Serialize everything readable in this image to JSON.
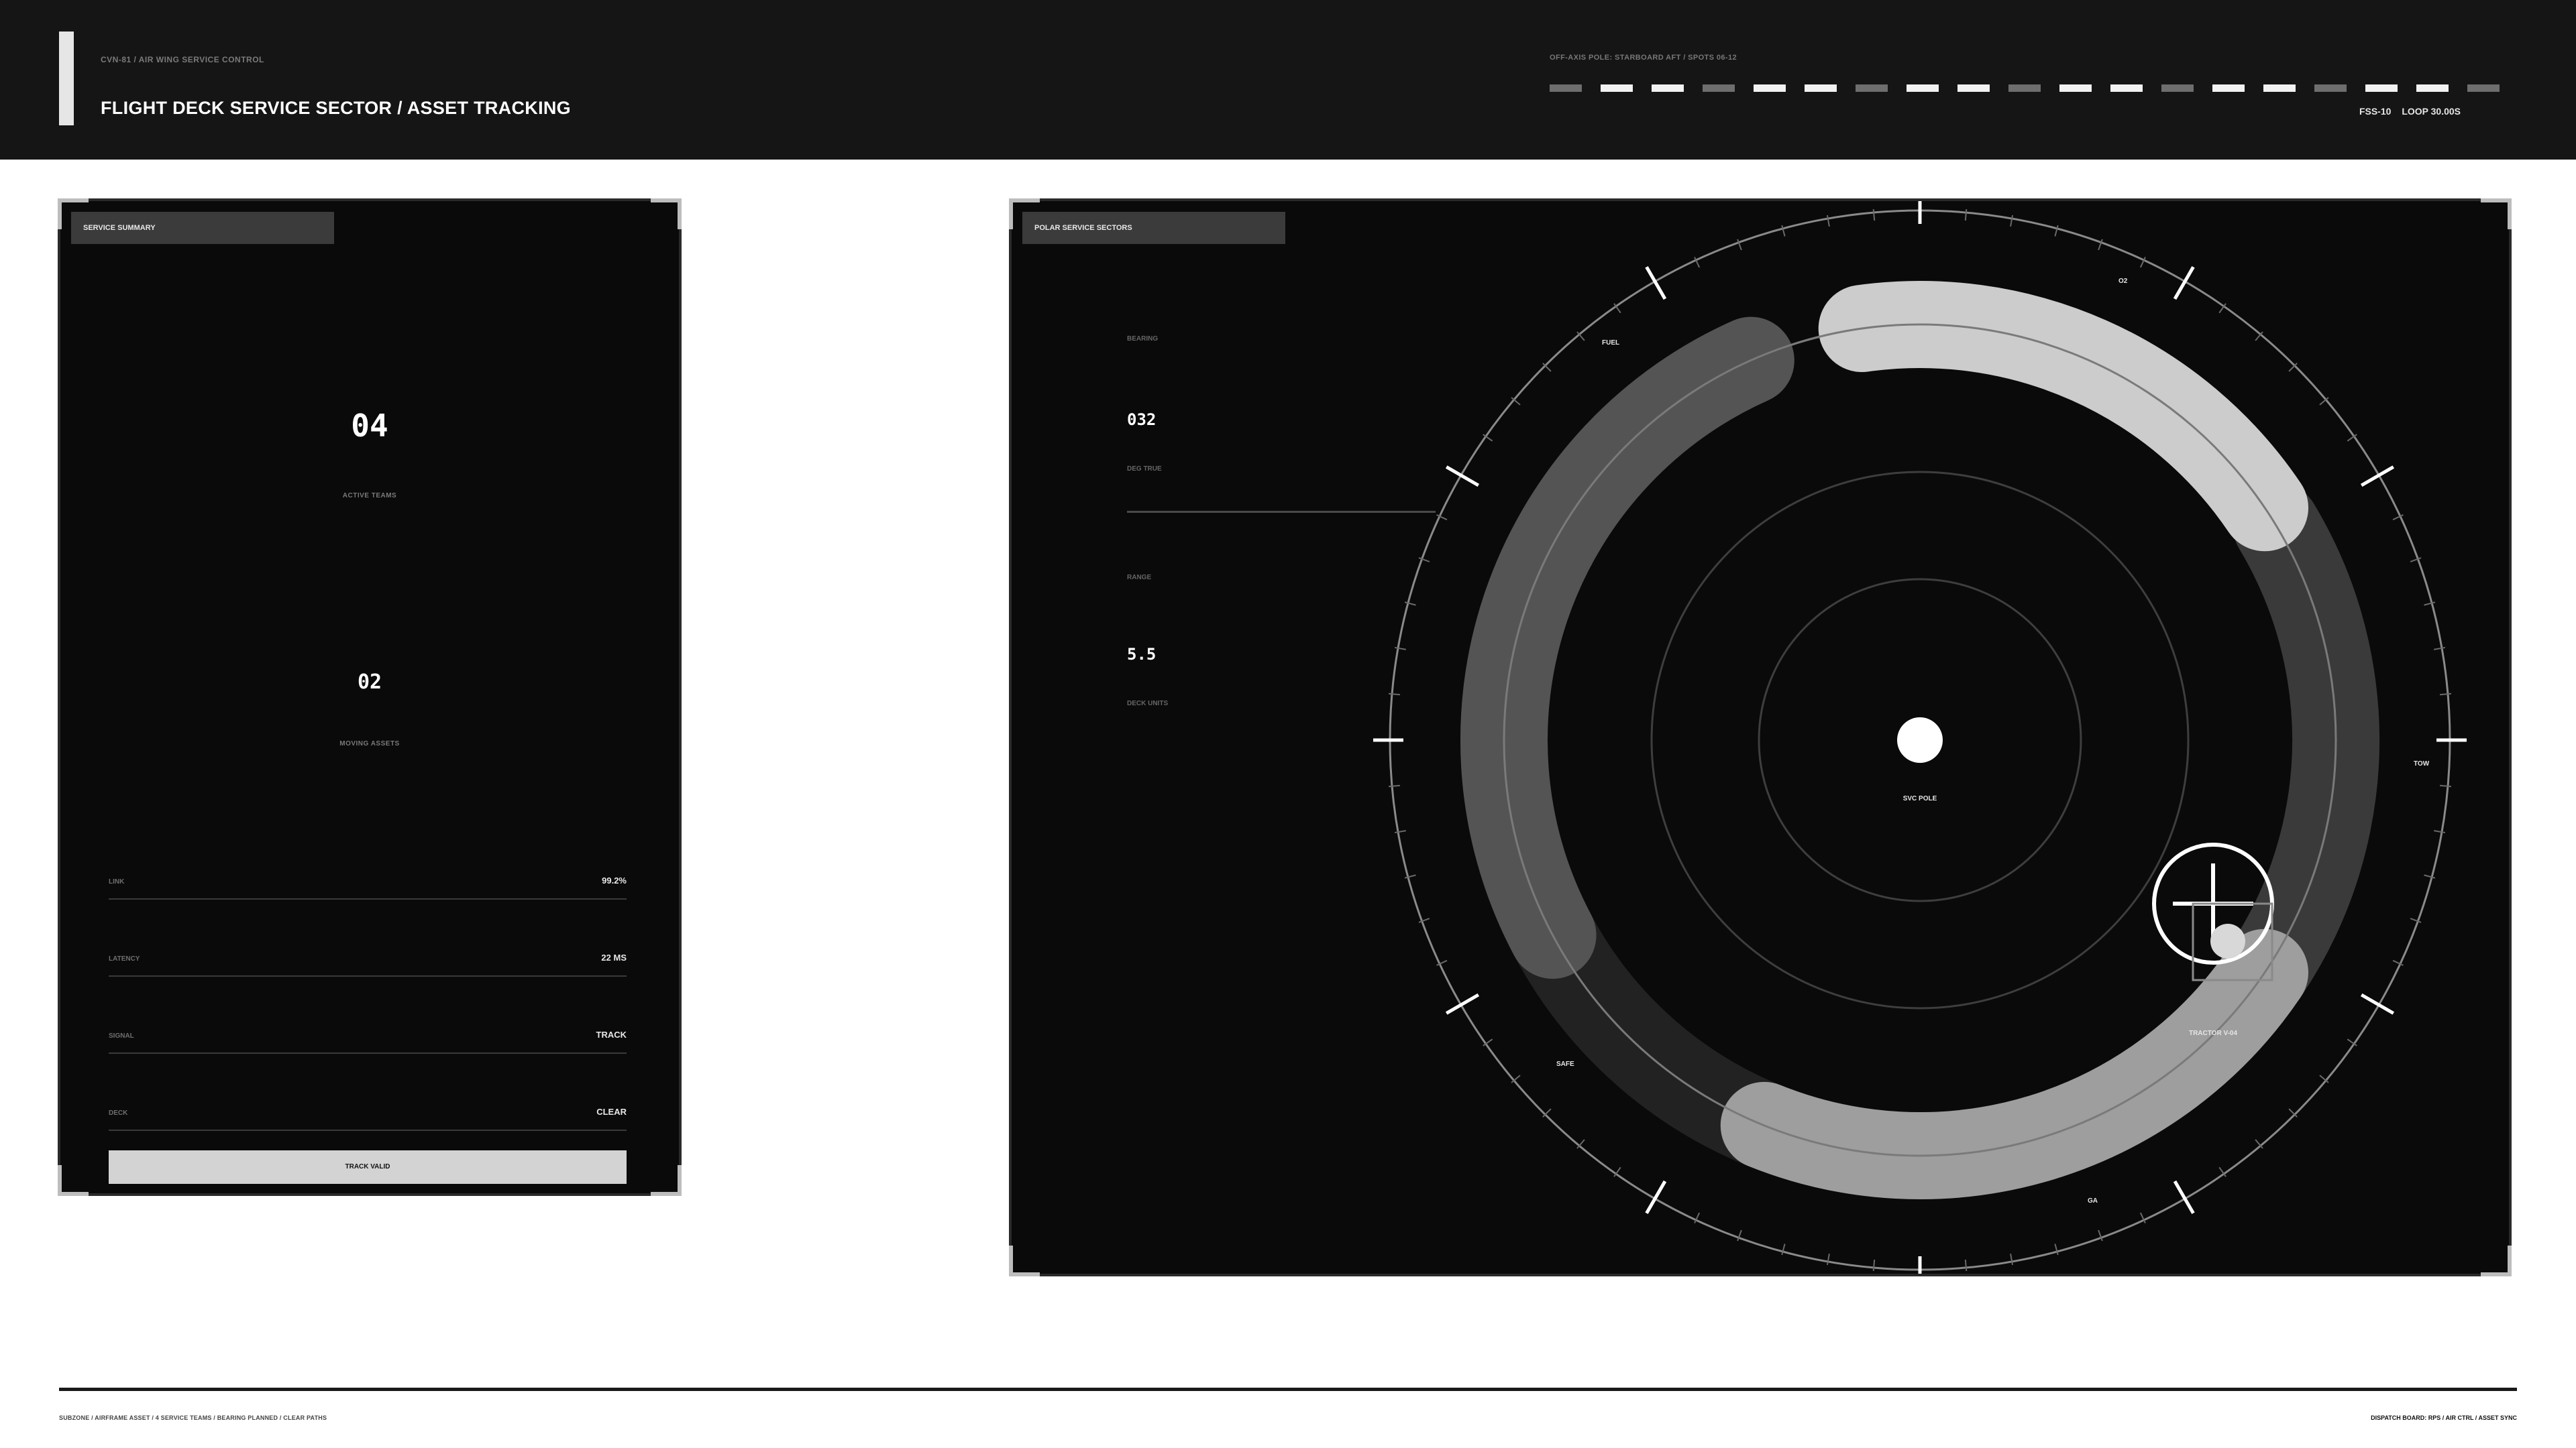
{
  "header": {
    "crumb": "CVN-81 / AIR WING SERVICE CONTROL",
    "title": "FLIGHT DECK SERVICE SECTOR / ASSET TRACKING",
    "axis_label": "OFF-AXIS POLE: STARBOARD AFT / SPOTS 06-12",
    "segments": [
      0,
      1,
      1,
      0,
      1,
      1,
      0,
      1,
      1,
      0,
      1,
      1,
      0,
      1,
      1,
      0,
      1,
      1,
      0
    ],
    "status_id": "FSS-10",
    "status_loop": "LOOP 30.00S"
  },
  "summary": {
    "tag": "SERVICE SUMMARY",
    "active_teams_value": "04",
    "active_teams_label": "ACTIVE TEAMS",
    "moving_assets_value": "02",
    "moving_assets_label": "MOVING ASSETS",
    "rows": [
      {
        "key": "LINK",
        "value": "99.2%"
      },
      {
        "key": "LATENCY",
        "value": "22 MS"
      },
      {
        "key": "SIGNAL",
        "value": "TRACK"
      },
      {
        "key": "DECK",
        "value": "CLEAR"
      }
    ],
    "button_label": "TRACK VALID"
  },
  "sectors": {
    "tag": "POLAR SERVICE SECTORS",
    "bearing_label": "BEARING",
    "bearing_value": "032",
    "bearing_unit": "DEG TRUE",
    "range_label": "RANGE",
    "range_value": "5.5",
    "range_unit": "DECK UNITS",
    "center_label": "SVC POLE",
    "asset_label": "TRACTOR V-04",
    "sector_labels": {
      "fuel": "FUEL",
      "o2": "O2",
      "tow": "TOW",
      "ga": "GA",
      "safe": "SAFE"
    },
    "colors": {
      "fuel": "#545454",
      "o2": "#cccccc",
      "tow": "#3a3a3a",
      "ga": "#9e9e9e",
      "safe": "#222222"
    }
  },
  "footer": {
    "left": "SUBZONE / AIRFRAME ASSET / 4 SERVICE TEAMS / BEARING PLANNED / CLEAR PATHS",
    "right": "DISPATCH BOARD: RPS / AIR CTRL / ASSET SYNC"
  }
}
